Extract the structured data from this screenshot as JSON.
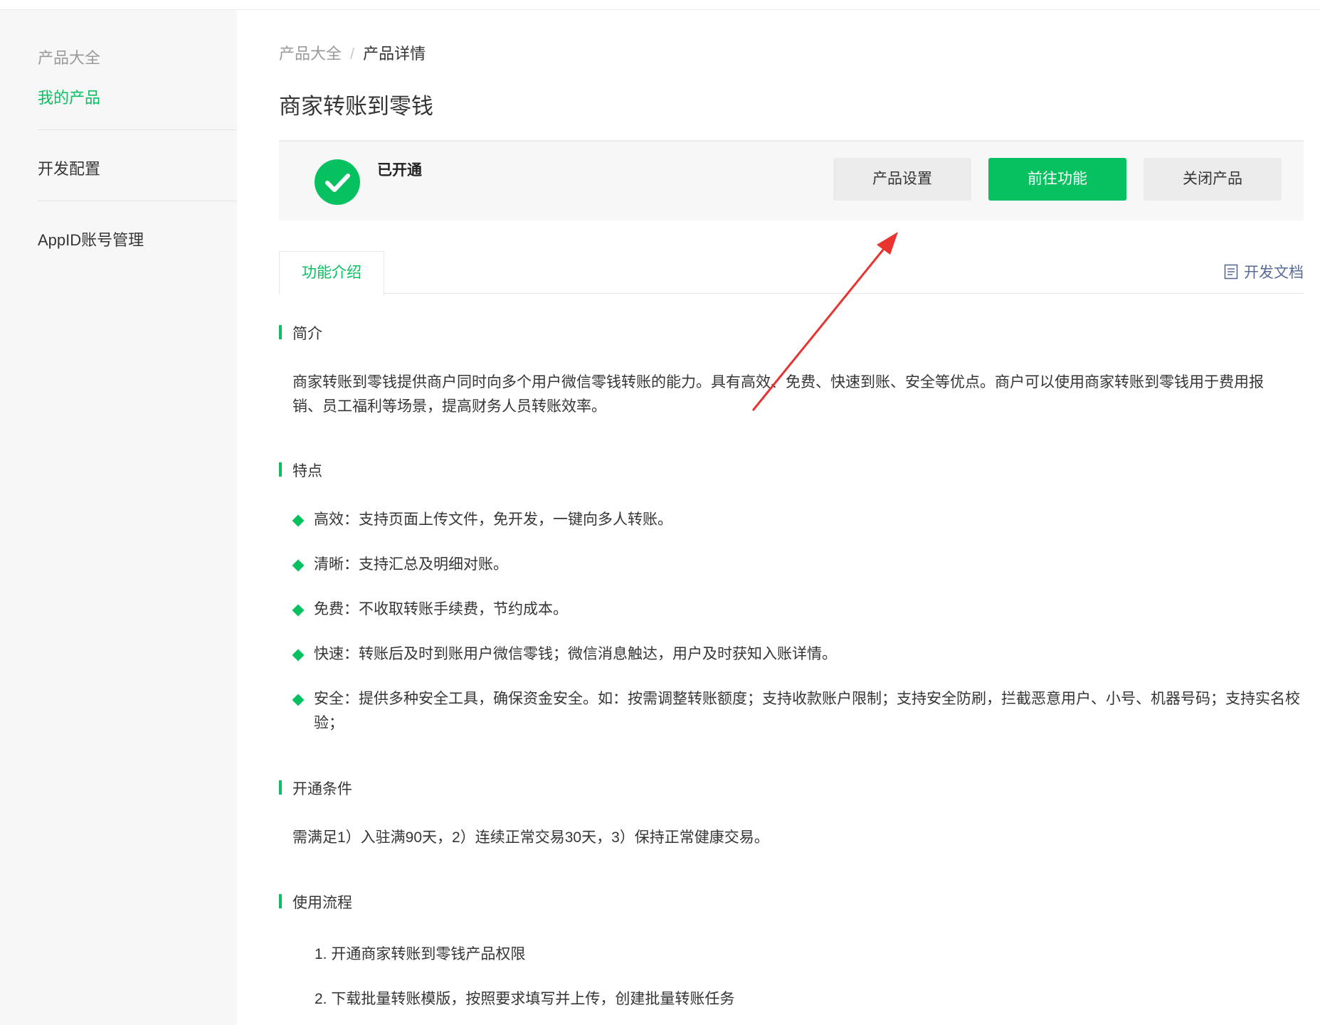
{
  "sidebar": {
    "items": [
      {
        "label": "产品大全"
      },
      {
        "label": "我的产品"
      },
      {
        "label": "开发配置"
      },
      {
        "label": "AppID账号管理"
      }
    ]
  },
  "breadcrumb": {
    "first": "产品大全",
    "separator": "/",
    "current": "产品详情"
  },
  "page": {
    "title": "商家转账到零钱"
  },
  "status": {
    "label": "已开通",
    "icon": "check-circle-icon"
  },
  "actions": {
    "settings": "产品设置",
    "go_function": "前往功能",
    "close_product": "关闭产品"
  },
  "tabs": {
    "intro": "功能介绍",
    "docs": "开发文档"
  },
  "sections": {
    "intro": {
      "heading": "简介",
      "text": "商家转账到零钱提供商户同时向多个用户微信零钱转账的能力。具有高效、免费、快速到账、安全等优点。商户可以使用商家转账到零钱用于费用报销、员工福利等场景，提高财务人员转账效率。"
    },
    "features": {
      "heading": "特点",
      "items": [
        "高效：支持页面上传文件，免开发，一键向多人转账。",
        "清晰：支持汇总及明细对账。",
        "免费：不收取转账手续费，节约成本。",
        "快速：转账后及时到账用户微信零钱；微信消息触达，用户及时获知入账详情。",
        "安全：提供多种安全工具，确保资金安全。如：按需调整转账额度；支持收款账户限制；支持安全防刷，拦截恶意用户、小号、机器号码；支持实名校验；"
      ]
    },
    "conditions": {
      "heading": "开通条件",
      "text": "需满足1）入驻满90天，2）连续正常交易30天，3）保持正常健康交易。"
    },
    "process": {
      "heading": "使用流程",
      "steps": [
        "1. 开通商家转账到零钱产品权限",
        "2. 下载批量转账模版，按照要求填写并上传，创建批量转账任务"
      ]
    }
  },
  "colors": {
    "accent": "#07c160",
    "annotation_arrow": "#e8332f",
    "link": "#576b95"
  }
}
